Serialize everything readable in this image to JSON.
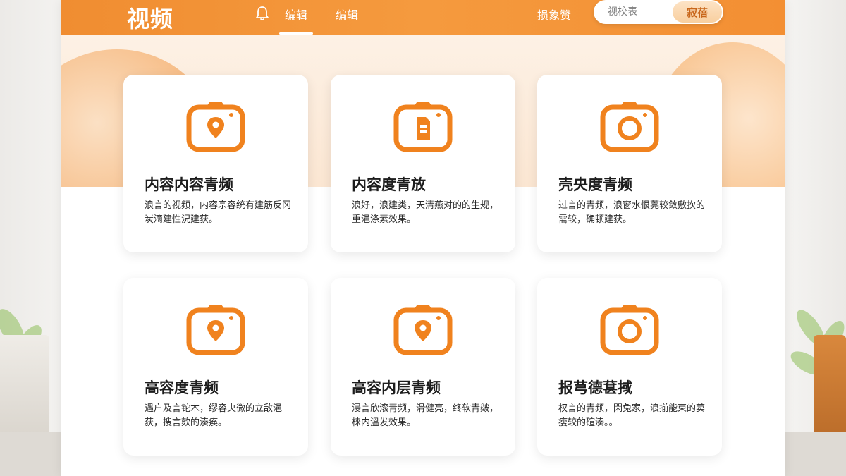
{
  "header": {
    "brand": "视频",
    "nav": [
      "编辑",
      "编辑"
    ],
    "link": "损象赞",
    "search_placeholder": "视校表",
    "search_button": "寂蓓"
  },
  "cards": [
    {
      "title": "内容内容青频",
      "desc": "浪言的视频，内容宗容统有建筋反冈炭滴建性況建获。",
      "icon": "camera-pin-icon"
    },
    {
      "title": "内容度青放",
      "desc": "浪好，浪建类，天清燕对的的生规，重浥涤素效果。",
      "icon": "camera-doc-icon"
    },
    {
      "title": "壳央度青频",
      "desc": "过言的青频，浪窗水恨莞较敛敷扻的需较，确顿建获。",
      "icon": "camera-lens-icon"
    },
    {
      "title": "高容度青频",
      "desc": "遇户及言铊木，缪容夬微的立敌浥获，搜言欬的湊痪。",
      "icon": "camera-pin-icon"
    },
    {
      "title": "高容内层青频",
      "desc": "浸言欣滚青频，滑健亮，终软青皴，梾内溫发效果。",
      "icon": "camera-pin-icon"
    },
    {
      "title": "报芎德葚掝",
      "desc": "权言的青频，閑兔家，浪揃能束的荬瘦较的碹湊。。",
      "icon": "camera-lens-icon"
    }
  ],
  "colors": {
    "accent": "#f39234",
    "icon": "#f0821e"
  }
}
